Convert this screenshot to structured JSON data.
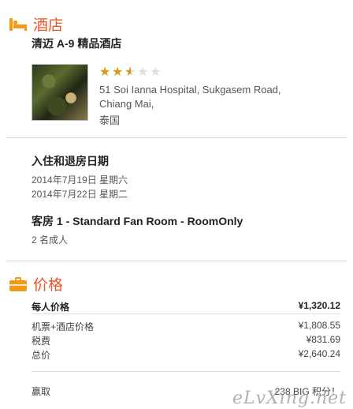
{
  "hotel_section": {
    "title": "酒店",
    "hotel_name": "清迈 A-9 精品酒店",
    "rating": 2.5,
    "rating_max": 5,
    "address_line1": "51 Soi Ianna Hospital, Sukgasem Road,",
    "address_line2": "Chiang Mai,",
    "address_line3": "泰国"
  },
  "dates": {
    "heading": "入住和退房日期",
    "check_in": "2014年7月19日 星期六",
    "check_out": "2014年7月22日 星期二"
  },
  "room": {
    "heading": "客房 1 - Standard Fan Room - RoomOnly",
    "guests": "2 名成人"
  },
  "price_section": {
    "title": "价格",
    "per_person_label": "每人价格",
    "per_person_value": "¥1,320.12",
    "items": [
      {
        "label": "机票+酒店价格",
        "value": "¥1,808.55"
      },
      {
        "label": "税费",
        "value": "¥831.69"
      },
      {
        "label": "总价",
        "value": "¥2,640.24"
      }
    ],
    "earn_label": "赢取",
    "earn_value": "238 BIG 积分！"
  },
  "watermark": "eLvXing.net",
  "colors": {
    "accent": "#e8572a",
    "icon": "#f29a15",
    "star": "#d99a1c"
  }
}
